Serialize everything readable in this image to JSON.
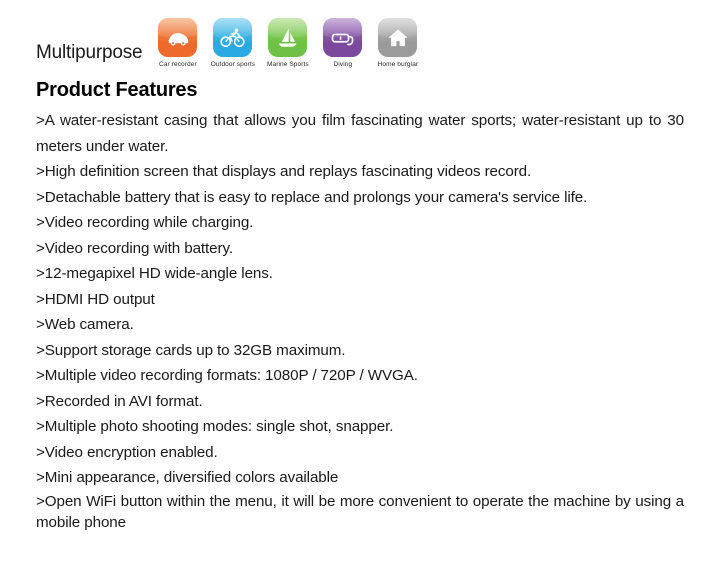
{
  "header": {
    "title": "Multipurpose",
    "icons": [
      {
        "label": "Car recorder",
        "icon": "car-icon",
        "color": "#ED6A2C",
        "color_light": "#F59B62"
      },
      {
        "label": "Outdoor sports",
        "icon": "bicycle-icon",
        "color": "#29ABE2",
        "color_light": "#6FCAEE"
      },
      {
        "label": "Marine Sports",
        "icon": "sailboat-icon",
        "color": "#6EC144",
        "color_light": "#A5D97E"
      },
      {
        "label": "Diving",
        "icon": "goggles-icon",
        "color": "#7B4A9E",
        "color_light": "#A67CC2"
      },
      {
        "label": "Home burglar",
        "icon": "home-icon",
        "color": "#9B9B9B",
        "color_light": "#C8C8C8"
      }
    ]
  },
  "main": {
    "heading": "Product Features",
    "features": [
      ">A water-resistant casing that allows you film fascinating water sports; water-resistant up to 30 meters under water.",
      ">High definition screen that displays and replays fascinating videos record.",
      ">Detachable battery that is easy to replace and prolongs your camera's service life.",
      ">Video recording while charging.",
      ">Video recording with battery.",
      ">12-megapixel HD wide-angle lens.",
      ">HDMI HD output",
      ">Web camera.",
      ">Support storage cards up to 32GB maximum.",
      ">Multiple video recording formats: 1080P / 720P / WVGA.",
      ">Recorded in AVI format.",
      ">Multiple photo shooting modes: single shot, snapper.",
      ">Video encryption enabled.",
      ">Mini appearance, diversified colors available",
      ">Open WiFi button within the menu, it will be more convenient to operate the machine by using a mobile phone"
    ]
  }
}
